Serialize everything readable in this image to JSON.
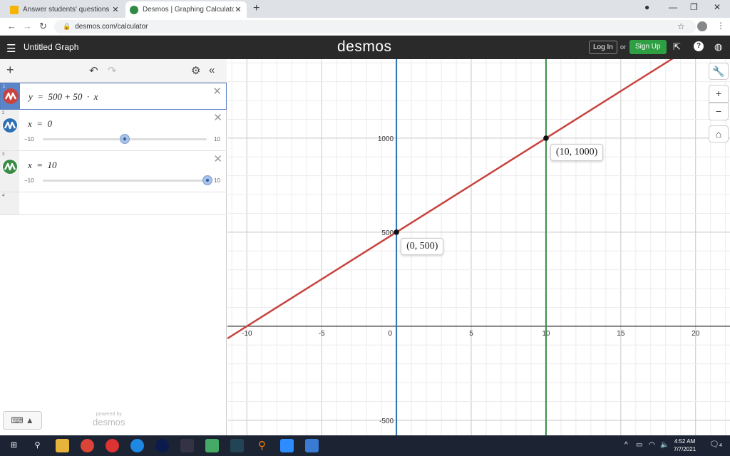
{
  "browser": {
    "tabs": [
      {
        "title": "Answer students' questions and",
        "close": "✕"
      },
      {
        "title": "Desmos | Graphing Calculator",
        "close": "✕"
      }
    ],
    "new_tab": "+",
    "url": "desmos.com/calculator"
  },
  "header": {
    "menu_icon": "hamburger-icon",
    "graph_title": "Untitled Graph",
    "logo": "desmos",
    "login_label": "Log In",
    "or_label": "or",
    "signup_label": "Sign Up"
  },
  "expressions": [
    {
      "index": "1",
      "latex": "y  =  500 + 50  ·  x",
      "color": "#c74440",
      "active": true
    },
    {
      "index": "2",
      "latex": "x  =  0",
      "color": "#2d70b3",
      "slider": {
        "min": "−10",
        "max": "10",
        "value": 0
      }
    },
    {
      "index": "3",
      "latex": "x  =  10",
      "color": "#388c46",
      "slider": {
        "min": "−10",
        "max": "10",
        "value": 10
      }
    },
    {
      "index": "4"
    }
  ],
  "powered_by": {
    "line1": "powered by",
    "line2": "desmos"
  },
  "graph": {
    "x_ticks": [
      "-10",
      "-5",
      "0",
      "5",
      "10",
      "15",
      "20"
    ],
    "y_ticks": [
      "1000",
      "500",
      "-500"
    ],
    "point_labels": [
      "(0, 500)",
      "(10, 1000)"
    ],
    "zoom_in": "+",
    "zoom_out": "−"
  },
  "chart_data": {
    "type": "line",
    "xlim": [
      -11.3,
      22.3
    ],
    "ylim": [
      -580,
      1420
    ],
    "grid": true,
    "series": [
      {
        "name": "y = 500 + 50 · x",
        "color": "#c74440",
        "kind": "function",
        "intercept": 500,
        "slope": 50
      },
      {
        "name": "x = 0",
        "color": "#2d70b3",
        "kind": "vertical",
        "x": 0
      },
      {
        "name": "x = 10",
        "color": "#388c46",
        "kind": "vertical",
        "x": 10
      }
    ],
    "points": [
      {
        "x": 0,
        "y": 500,
        "label": "(0, 500)"
      },
      {
        "x": 10,
        "y": 1000,
        "label": "(10, 1000)"
      }
    ]
  },
  "taskbar": {
    "time": "4:52 AM",
    "date": "7/7/2021",
    "notifications": "4"
  }
}
